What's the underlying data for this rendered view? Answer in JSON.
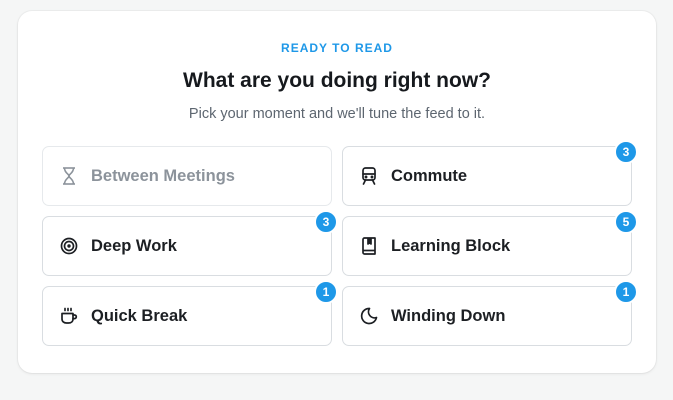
{
  "header": {
    "eyebrow": "READY TO READ",
    "title": "What are you doing right now?",
    "subtitle": "Pick your moment and we'll tune the feed to it."
  },
  "options": [
    {
      "label": "Between Meetings",
      "icon": "hourglass-icon",
      "badge": null,
      "disabled": true
    },
    {
      "label": "Commute",
      "icon": "train-icon",
      "badge": "3",
      "disabled": false
    },
    {
      "label": "Deep Work",
      "icon": "target-icon",
      "badge": "3",
      "disabled": false
    },
    {
      "label": "Learning Block",
      "icon": "book-icon",
      "badge": "5",
      "disabled": false
    },
    {
      "label": "Quick Break",
      "icon": "coffee-cup-icon",
      "badge": "1",
      "disabled": false
    },
    {
      "label": "Winding Down",
      "icon": "moon-icon",
      "badge": "1",
      "disabled": false
    }
  ],
  "colors": {
    "accent": "#1e98e8",
    "text": "#1c1f23",
    "muted": "#8c939b"
  }
}
